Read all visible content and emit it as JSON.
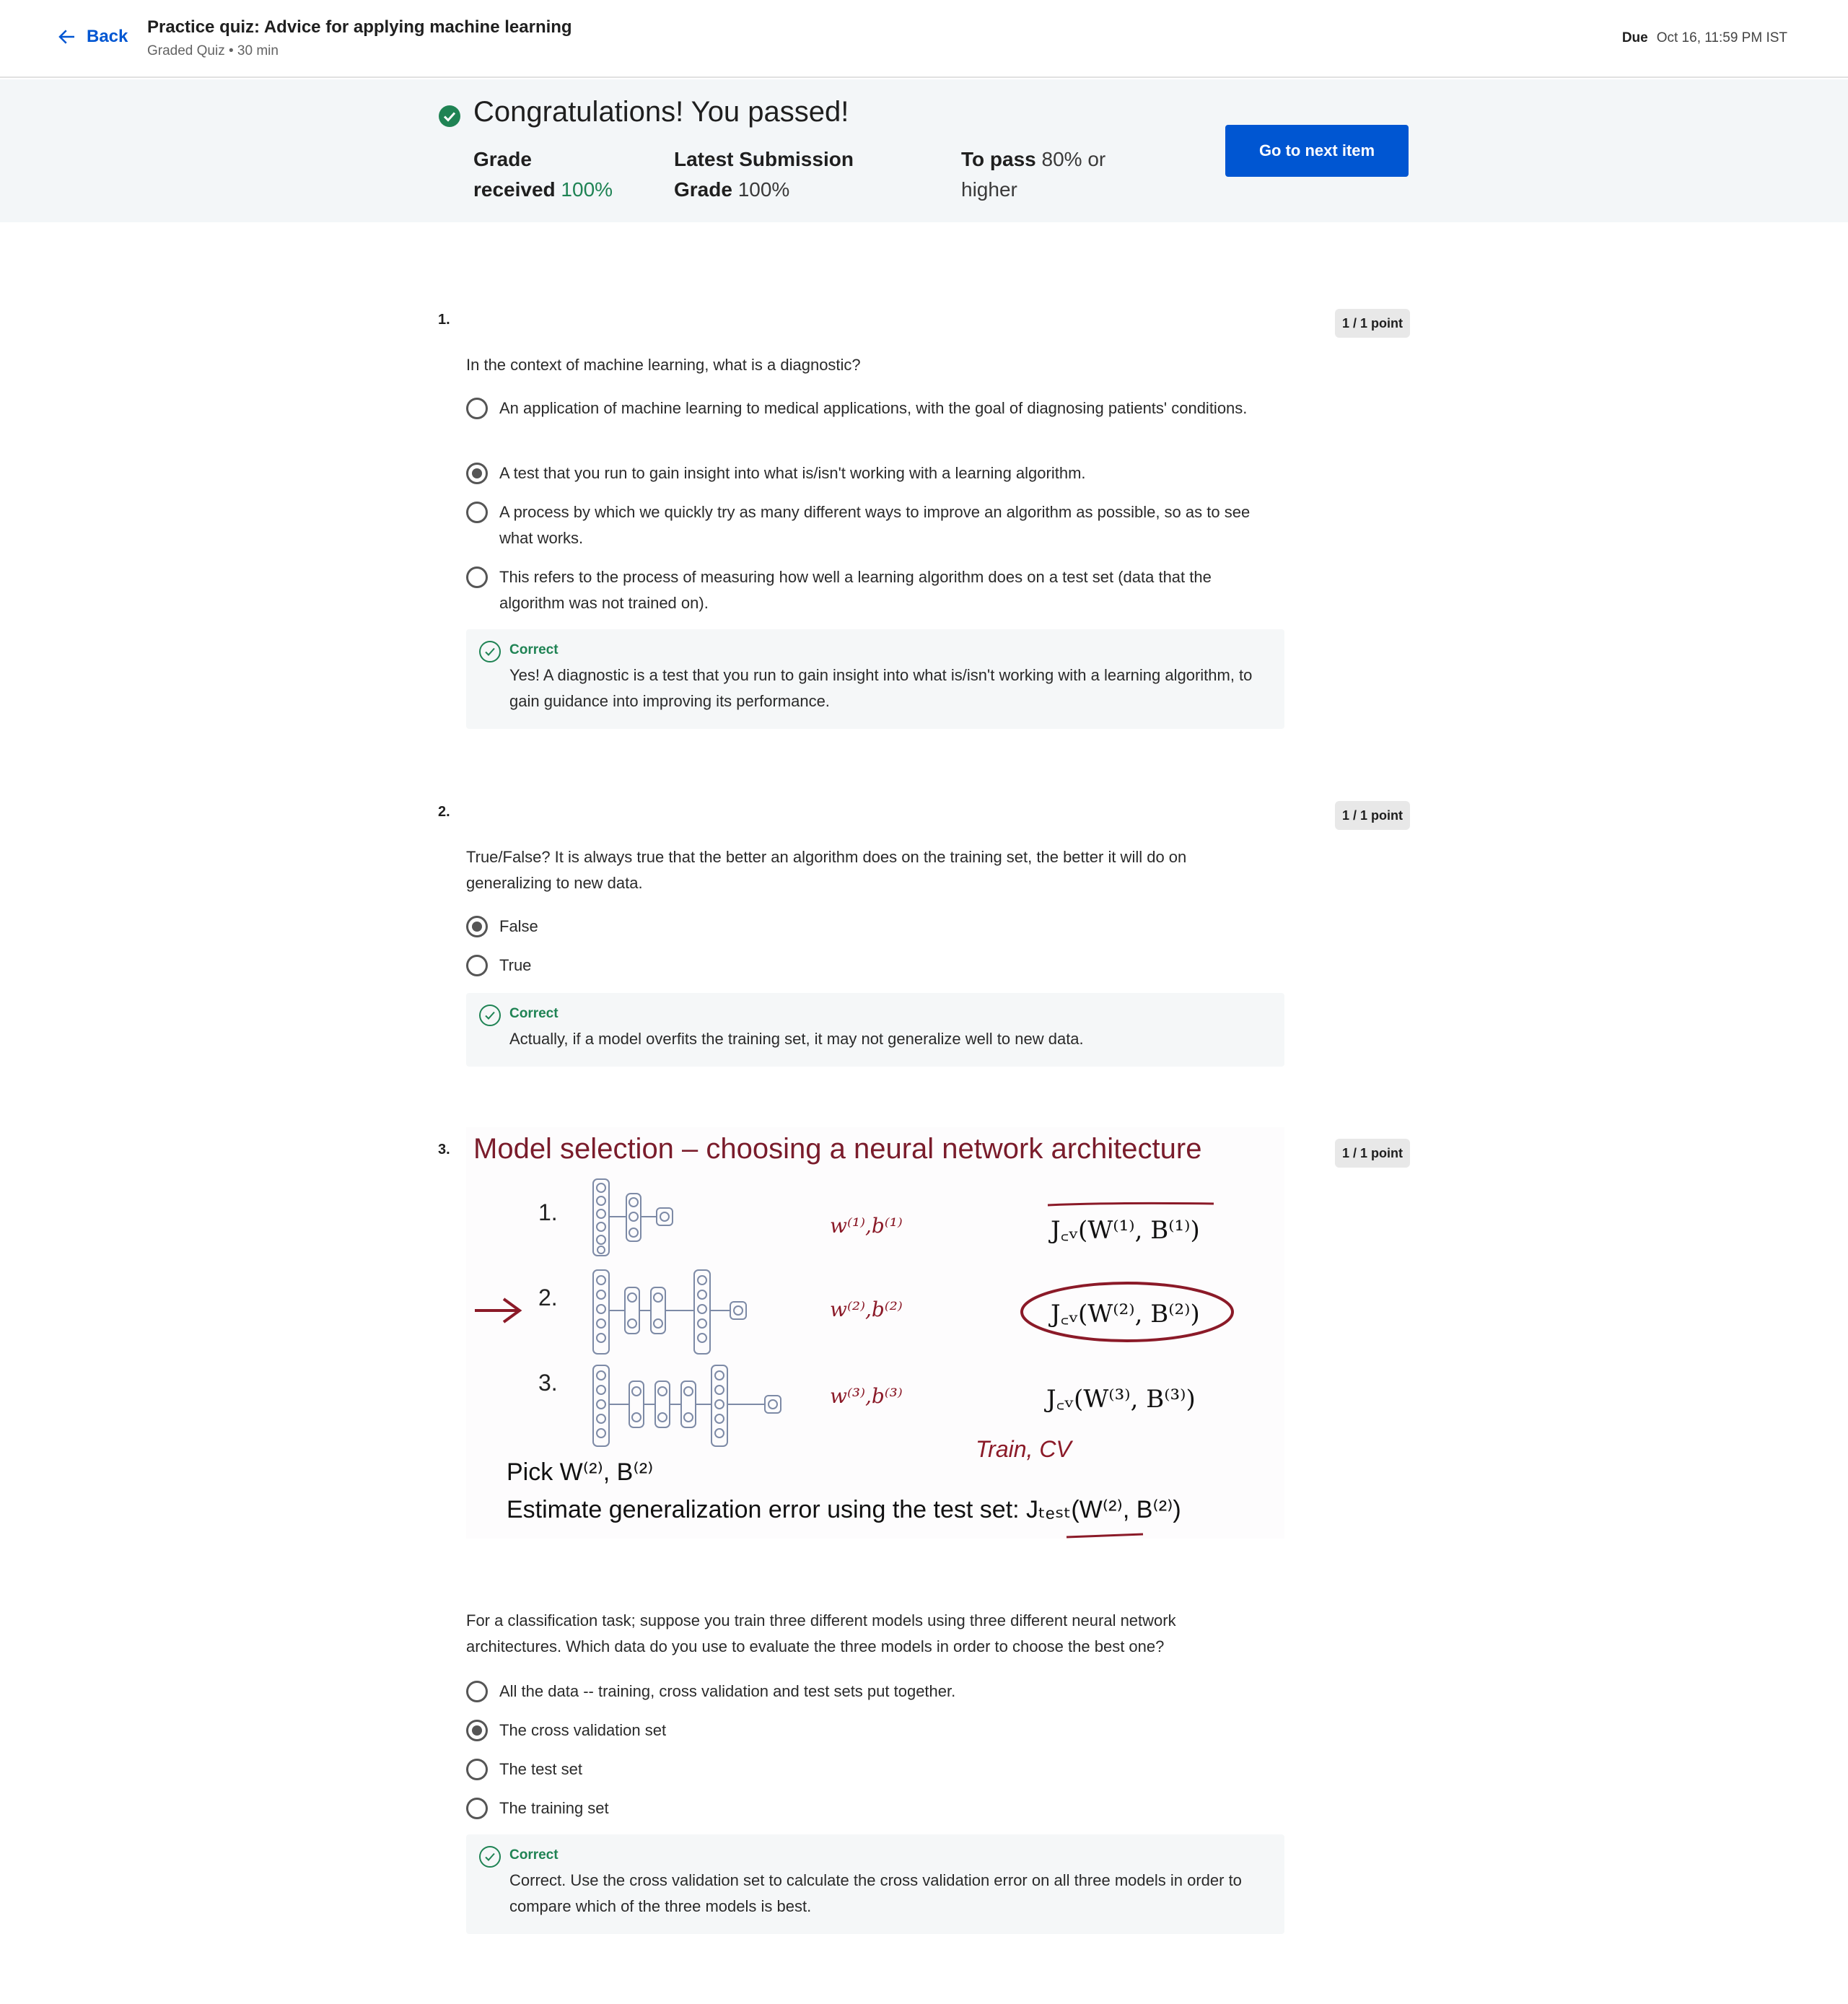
{
  "header": {
    "back_label": "Back",
    "title": "Practice quiz: Advice for applying machine learning",
    "subtitle": "Graded Quiz • 30 min",
    "due_label": "Due",
    "due_value": "Oct 16, 11:59 PM IST"
  },
  "banner": {
    "congrats": "Congratulations! You passed!",
    "grade_label_1": "Grade",
    "grade_label_2": "received",
    "grade_value": "100%",
    "latest_label_1": "Latest Submission",
    "latest_label_2": "Grade",
    "latest_value": "100%",
    "topass_label": "To pass",
    "topass_value_1": "80% or",
    "topass_value_2": "higher",
    "next_button": "Go to next item",
    "accent_color": "#0056d2",
    "pass_color": "#1f8354"
  },
  "questions": [
    {
      "number": "1.",
      "points": "1 / 1 point",
      "text": "In the context of machine learning, what is a diagnostic?",
      "options": [
        {
          "label": "An application of machine learning to medical applications, with the goal of diagnosing patients' conditions.",
          "selected": false
        },
        {
          "label": "A test that you run to gain insight into what is/isn't working with a learning algorithm.",
          "selected": true
        },
        {
          "label": "A process by which we quickly try as many different ways to improve an algorithm as possible, so as to see what works.",
          "selected": false
        },
        {
          "label": "This refers to the process of measuring how well a learning algorithm does on a test set (data that the algorithm was not trained on).",
          "selected": false
        }
      ],
      "feedback_head": "Correct",
      "feedback_text": "Yes! A diagnostic is a test that you run to gain insight into what is/isn't working with a learning algorithm, to gain guidance into improving its performance."
    },
    {
      "number": "2.",
      "points": "1 / 1 point",
      "text": "True/False? It is always true that the better an algorithm does on the training set, the better it will do on generalizing to new data.",
      "options": [
        {
          "label": "False",
          "selected": true
        },
        {
          "label": "True",
          "selected": false
        }
      ],
      "feedback_head": "Correct",
      "feedback_text": "Actually, if a model overfits the training set, it may not generalize well to new data."
    },
    {
      "number": "3.",
      "points": "1 / 1 point",
      "slide": {
        "title": "Model selection – choosing a neural network architecture",
        "row1": "1.",
        "row2": "2.",
        "row3": "3.",
        "wb1": "w⁽¹⁾,b⁽¹⁾",
        "wb2": "w⁽²⁾,b⁽²⁾",
        "wb3": "w⁽³⁾,b⁽³⁾",
        "j1": "J꜀ᵥ(W⁽¹⁾, B⁽¹⁾)",
        "j2": "J꜀ᵥ(W⁽²⁾, B⁽²⁾)",
        "j3": "J꜀ᵥ(W⁽³⁾, B⁽³⁾)",
        "train_cv": "Train, CV",
        "pick": "Pick W⁽²⁾, B⁽²⁾",
        "estimate": "Estimate generalization error using the test set: Jₜₑₛₜ(W⁽²⁾, B⁽²⁾)"
      },
      "text": "For a classification task; suppose you train three different models using three different neural network architectures. Which data do you use to evaluate the three models in order to choose the best one?",
      "options": [
        {
          "label": "All the data -- training, cross validation and test sets put together.",
          "selected": false
        },
        {
          "label": "The cross validation set",
          "selected": true
        },
        {
          "label": "The test set",
          "selected": false
        },
        {
          "label": "The training set",
          "selected": false
        }
      ],
      "feedback_head": "Correct",
      "feedback_text": "Correct. Use the cross validation set to calculate the cross validation error on all three models in order to compare which of the three models is best."
    }
  ]
}
